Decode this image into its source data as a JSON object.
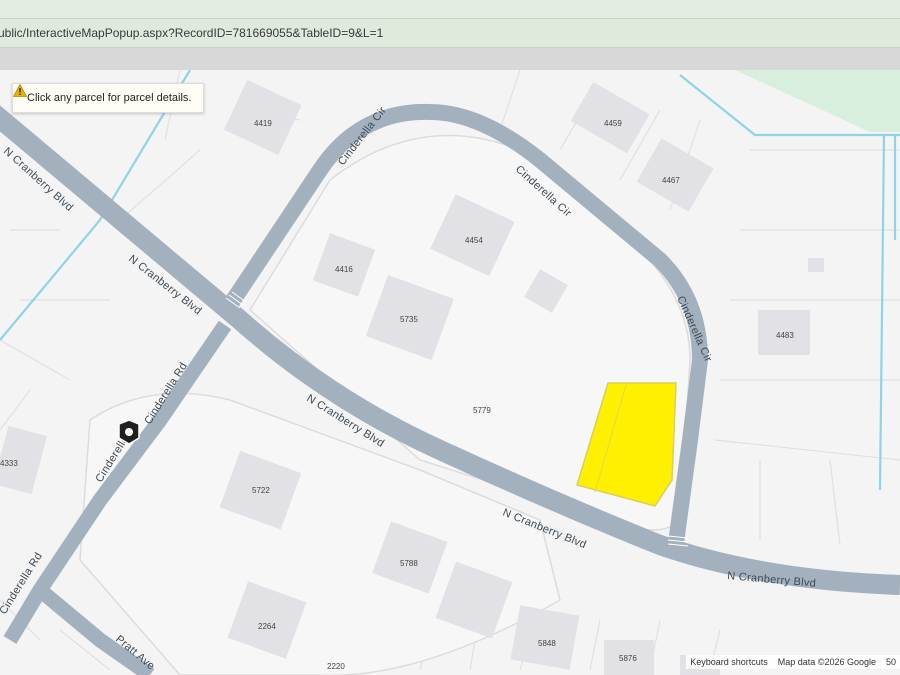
{
  "browser": {
    "url": "ublic/InteractiveMapPopup.aspx?RecordID=781669055&TableID=9&L=1"
  },
  "map": {
    "info_message": "Click any parcel for parcel details.",
    "roads": {
      "n_cranberry_1": "N Cranberry Blvd",
      "n_cranberry_2": "N Cranberry Blvd",
      "n_cranberry_3": "N Cranberry Blvd",
      "n_cranberry_4": "N Cranberry Blvd",
      "n_cranberry_5": "N Cranberry Blvd",
      "cinderella_cir_1": "Cinderella Cir",
      "cinderella_cir_2": "Cinderella Cir",
      "cinderella_cir_3": "Cinderella Cir",
      "cinderella_rd_1": "Cinderella Rd",
      "cinderella_rd_2": "Cinderella Rd",
      "cinderella_rd_3": "Cinderella Rd",
      "pratt_ave": "Pratt Ave"
    },
    "addresses": {
      "a4419": "4419",
      "a4459": "4459",
      "a4467": "4467",
      "a4454": "4454",
      "a4416": "4416",
      "a5735": "5735",
      "a4483": "4483",
      "a5779": "5779",
      "a4333": "4333",
      "a5722": "5722",
      "a5788": "5788",
      "a2264": "2264",
      "a5848": "5848",
      "a5876": "5876",
      "a2220": "2220"
    },
    "highlight_color": "#ffef00",
    "footer": {
      "shortcuts": "Keyboard shortcuts",
      "map_data": "Map data ©2026 Google",
      "scale": "50"
    }
  }
}
